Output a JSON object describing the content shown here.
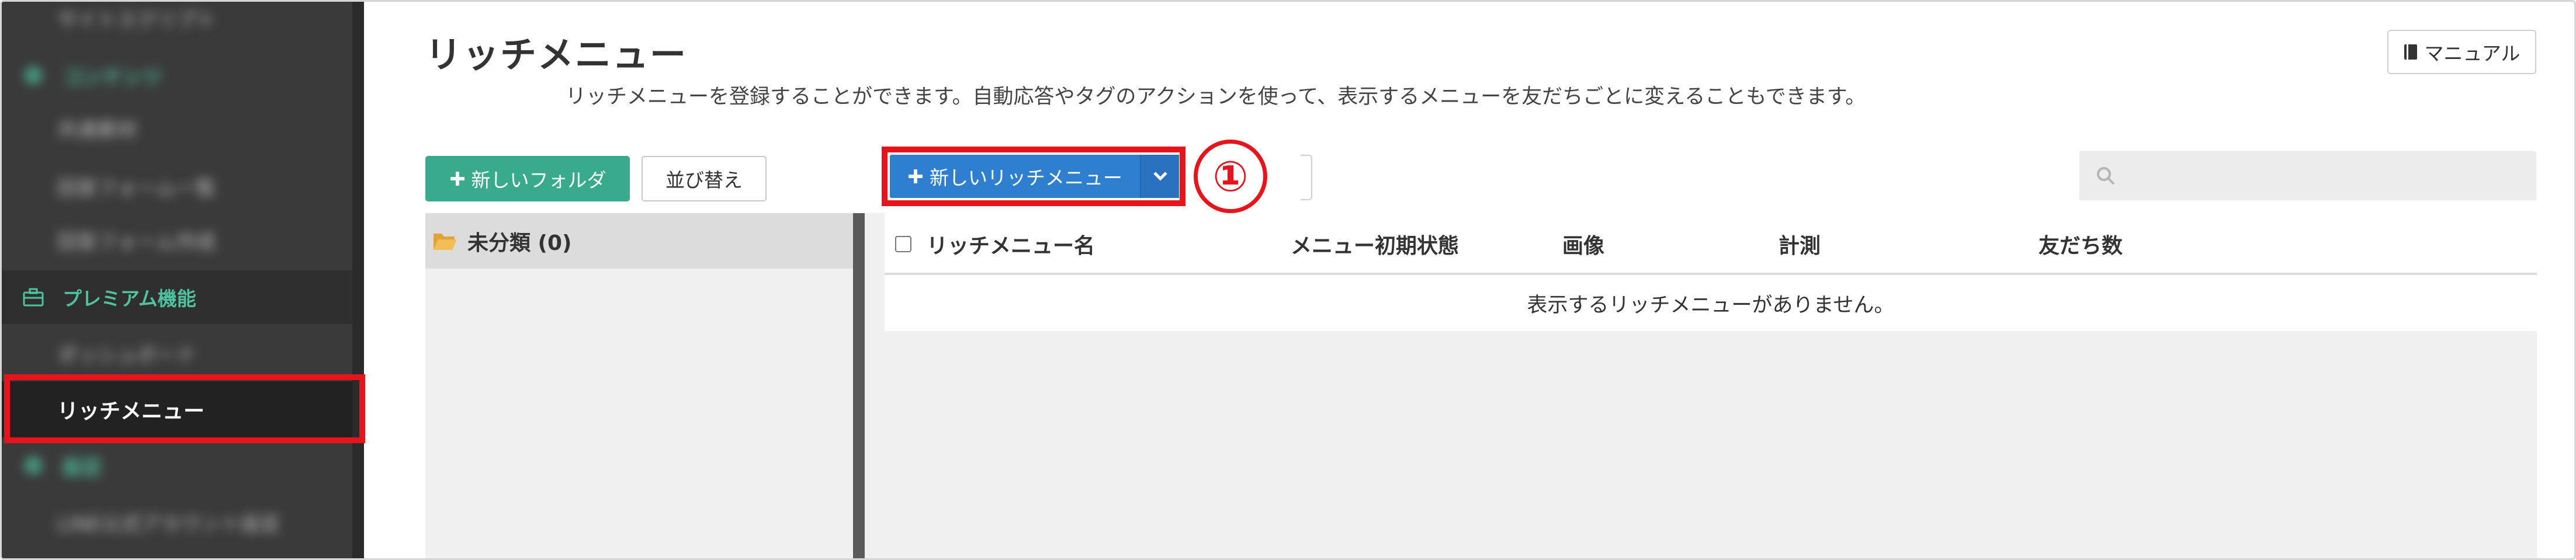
{
  "sidebar": {
    "items": [
      {
        "label": "サイトスクリプト"
      },
      {
        "label": "コンテンツ"
      },
      {
        "label": "共通素材"
      },
      {
        "label": "回答フォーム一覧"
      },
      {
        "label": "回答フォーム作成"
      },
      {
        "label": "プレミアム機能"
      },
      {
        "label": "ダッシュボード"
      },
      {
        "label": "リッチメニュー"
      },
      {
        "label": "設定"
      },
      {
        "label": "LINE公式アカウント設定"
      }
    ]
  },
  "header": {
    "title": "リッチメニュー",
    "description": "リッチメニューを登録することができます。自動応答やタグのアクションを使って、表示するメニューを友だちごとに変えることもできます。",
    "manual_label": "マニュアル"
  },
  "toolbar": {
    "new_folder_label": "新しいフォルダ",
    "sort_label": "並び替え",
    "new_rich_menu_label": "新しいリッチメニュー",
    "step_marker": "①",
    "search_placeholder": ""
  },
  "folders": [
    {
      "name": "未分類 (0)"
    }
  ],
  "table": {
    "columns": [
      "リッチメニュー名",
      "メニュー初期状態",
      "画像",
      "計測",
      "友だち数"
    ],
    "empty_message": "表示するリッチメニューがありません。"
  },
  "colors": {
    "sidebar_bg": "#3a3a3a",
    "accent_green": "#3aaa8c",
    "primary_blue": "#2f7fd0",
    "highlight_red": "#e8141c"
  },
  "icons": {
    "premium": "briefcase-icon",
    "manual": "book-icon",
    "folder": "folder-open-icon",
    "search": "search-icon",
    "dropdown": "chevron-down-icon",
    "plus": "plus-icon"
  }
}
